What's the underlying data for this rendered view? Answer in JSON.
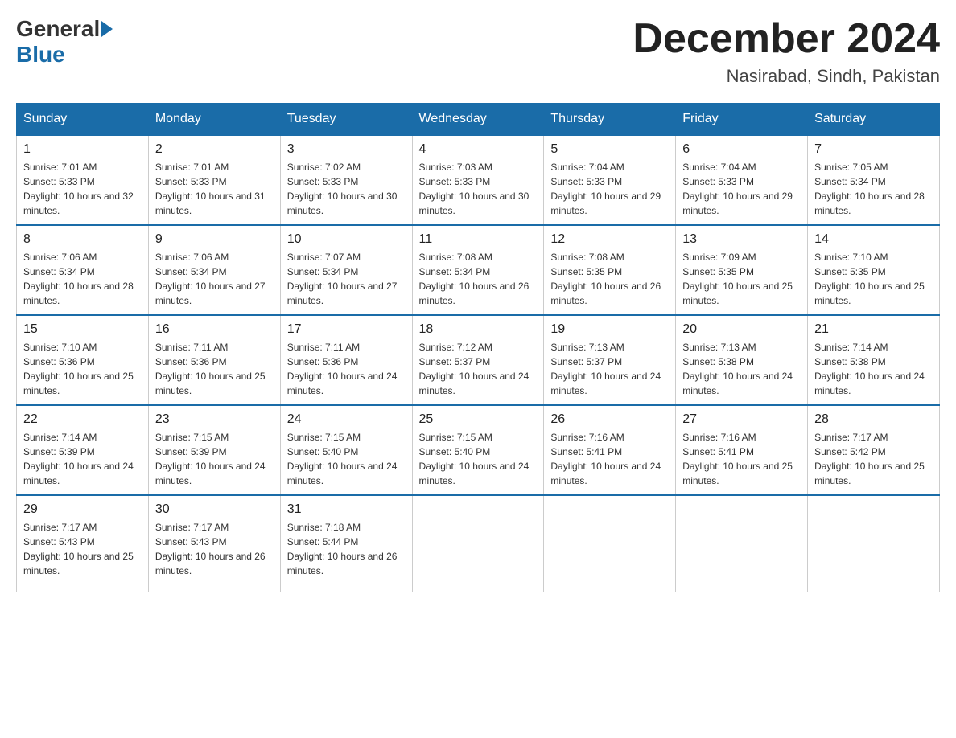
{
  "header": {
    "logo_general": "General",
    "logo_blue": "Blue",
    "month_title": "December 2024",
    "location": "Nasirabad, Sindh, Pakistan"
  },
  "weekdays": [
    "Sunday",
    "Monday",
    "Tuesday",
    "Wednesday",
    "Thursday",
    "Friday",
    "Saturday"
  ],
  "weeks": [
    [
      {
        "day": "1",
        "sunrise": "7:01 AM",
        "sunset": "5:33 PM",
        "daylight": "10 hours and 32 minutes."
      },
      {
        "day": "2",
        "sunrise": "7:01 AM",
        "sunset": "5:33 PM",
        "daylight": "10 hours and 31 minutes."
      },
      {
        "day": "3",
        "sunrise": "7:02 AM",
        "sunset": "5:33 PM",
        "daylight": "10 hours and 30 minutes."
      },
      {
        "day": "4",
        "sunrise": "7:03 AM",
        "sunset": "5:33 PM",
        "daylight": "10 hours and 30 minutes."
      },
      {
        "day": "5",
        "sunrise": "7:04 AM",
        "sunset": "5:33 PM",
        "daylight": "10 hours and 29 minutes."
      },
      {
        "day": "6",
        "sunrise": "7:04 AM",
        "sunset": "5:33 PM",
        "daylight": "10 hours and 29 minutes."
      },
      {
        "day": "7",
        "sunrise": "7:05 AM",
        "sunset": "5:34 PM",
        "daylight": "10 hours and 28 minutes."
      }
    ],
    [
      {
        "day": "8",
        "sunrise": "7:06 AM",
        "sunset": "5:34 PM",
        "daylight": "10 hours and 28 minutes."
      },
      {
        "day": "9",
        "sunrise": "7:06 AM",
        "sunset": "5:34 PM",
        "daylight": "10 hours and 27 minutes."
      },
      {
        "day": "10",
        "sunrise": "7:07 AM",
        "sunset": "5:34 PM",
        "daylight": "10 hours and 27 minutes."
      },
      {
        "day": "11",
        "sunrise": "7:08 AM",
        "sunset": "5:34 PM",
        "daylight": "10 hours and 26 minutes."
      },
      {
        "day": "12",
        "sunrise": "7:08 AM",
        "sunset": "5:35 PM",
        "daylight": "10 hours and 26 minutes."
      },
      {
        "day": "13",
        "sunrise": "7:09 AM",
        "sunset": "5:35 PM",
        "daylight": "10 hours and 25 minutes."
      },
      {
        "day": "14",
        "sunrise": "7:10 AM",
        "sunset": "5:35 PM",
        "daylight": "10 hours and 25 minutes."
      }
    ],
    [
      {
        "day": "15",
        "sunrise": "7:10 AM",
        "sunset": "5:36 PM",
        "daylight": "10 hours and 25 minutes."
      },
      {
        "day": "16",
        "sunrise": "7:11 AM",
        "sunset": "5:36 PM",
        "daylight": "10 hours and 25 minutes."
      },
      {
        "day": "17",
        "sunrise": "7:11 AM",
        "sunset": "5:36 PM",
        "daylight": "10 hours and 24 minutes."
      },
      {
        "day": "18",
        "sunrise": "7:12 AM",
        "sunset": "5:37 PM",
        "daylight": "10 hours and 24 minutes."
      },
      {
        "day": "19",
        "sunrise": "7:13 AM",
        "sunset": "5:37 PM",
        "daylight": "10 hours and 24 minutes."
      },
      {
        "day": "20",
        "sunrise": "7:13 AM",
        "sunset": "5:38 PM",
        "daylight": "10 hours and 24 minutes."
      },
      {
        "day": "21",
        "sunrise": "7:14 AM",
        "sunset": "5:38 PM",
        "daylight": "10 hours and 24 minutes."
      }
    ],
    [
      {
        "day": "22",
        "sunrise": "7:14 AM",
        "sunset": "5:39 PM",
        "daylight": "10 hours and 24 minutes."
      },
      {
        "day": "23",
        "sunrise": "7:15 AM",
        "sunset": "5:39 PM",
        "daylight": "10 hours and 24 minutes."
      },
      {
        "day": "24",
        "sunrise": "7:15 AM",
        "sunset": "5:40 PM",
        "daylight": "10 hours and 24 minutes."
      },
      {
        "day": "25",
        "sunrise": "7:15 AM",
        "sunset": "5:40 PM",
        "daylight": "10 hours and 24 minutes."
      },
      {
        "day": "26",
        "sunrise": "7:16 AM",
        "sunset": "5:41 PM",
        "daylight": "10 hours and 24 minutes."
      },
      {
        "day": "27",
        "sunrise": "7:16 AM",
        "sunset": "5:41 PM",
        "daylight": "10 hours and 25 minutes."
      },
      {
        "day": "28",
        "sunrise": "7:17 AM",
        "sunset": "5:42 PM",
        "daylight": "10 hours and 25 minutes."
      }
    ],
    [
      {
        "day": "29",
        "sunrise": "7:17 AM",
        "sunset": "5:43 PM",
        "daylight": "10 hours and 25 minutes."
      },
      {
        "day": "30",
        "sunrise": "7:17 AM",
        "sunset": "5:43 PM",
        "daylight": "10 hours and 26 minutes."
      },
      {
        "day": "31",
        "sunrise": "7:18 AM",
        "sunset": "5:44 PM",
        "daylight": "10 hours and 26 minutes."
      },
      null,
      null,
      null,
      null
    ]
  ],
  "labels": {
    "sunrise_prefix": "Sunrise: ",
    "sunset_prefix": "Sunset: ",
    "daylight_prefix": "Daylight: "
  }
}
